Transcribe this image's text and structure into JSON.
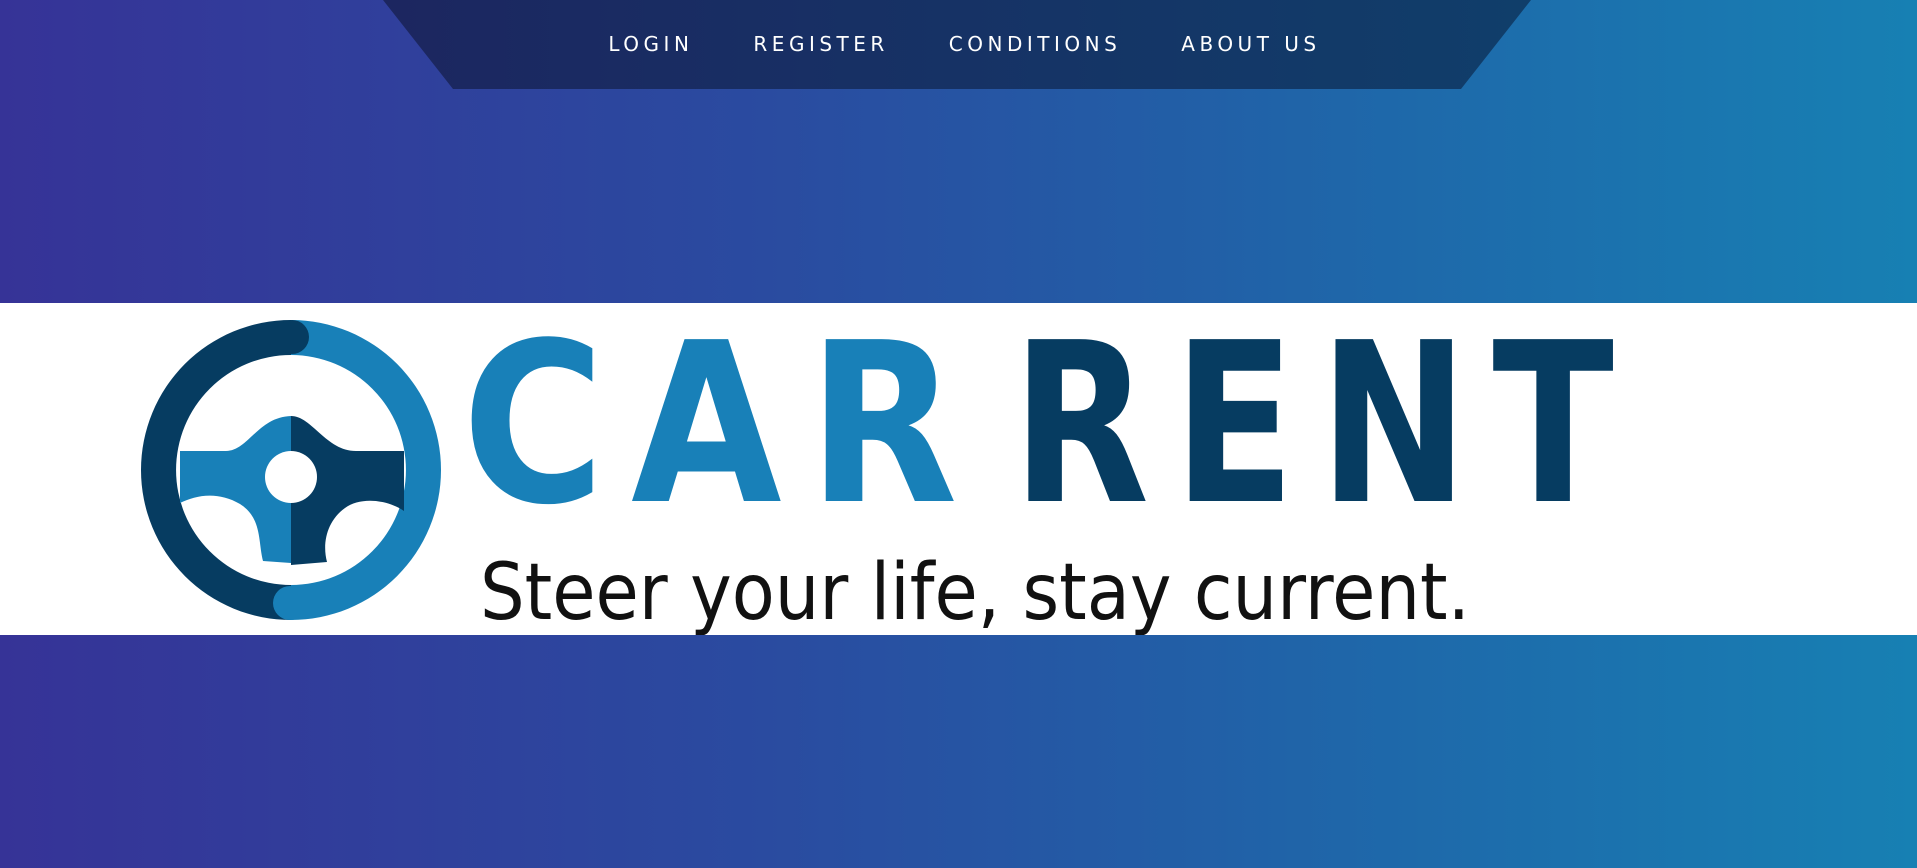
{
  "nav": {
    "links": [
      {
        "label": "LOGIN"
      },
      {
        "label": "REGISTER"
      },
      {
        "label": "CONDITIONS"
      },
      {
        "label": "ABOUT US"
      }
    ]
  },
  "logo": {
    "wordmark_part1": "CAR",
    "wordmark_part2": "RENT",
    "tagline": "Steer your life, stay current."
  },
  "colors": {
    "light_blue": "#1880b8",
    "dark_blue": "#063c61",
    "nav_dark": "#1a2a5e",
    "tagline": "#111111"
  }
}
